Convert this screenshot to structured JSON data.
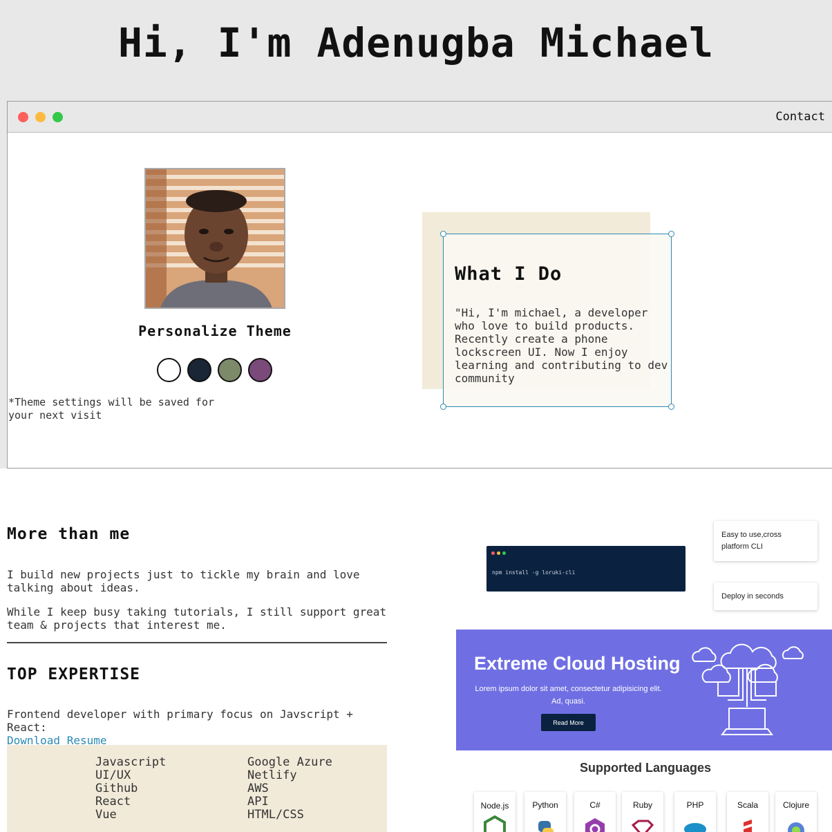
{
  "hero": {
    "title": "Hi, I'm Adenugba Michael"
  },
  "window": {
    "contact_label": "Contact"
  },
  "profile": {
    "theme_title": "Personalize Theme",
    "theme_swatches": [
      "#ffffff",
      "#1a2535",
      "#7d8a6a",
      "#7a4a7a"
    ],
    "theme_note": "*Theme settings will be saved for your next visit"
  },
  "what_i_do": {
    "title": "What I Do",
    "text": "\"Hi, I'm michael, a developer who love to build products. Recently create a phone lockscreen UI. Now I enjoy learning and contributing to dev community"
  },
  "about": {
    "title": "More than me",
    "paragraph_1": "I build new projects just to tickle my brain and love talking about ideas.",
    "paragraph_2": "While I keep busy taking tutorials, I still support great team & projects that interest me."
  },
  "expertise": {
    "title": "TOP EXPERTISE",
    "intro": "Frontend developer with primary focus on Javscript + React:",
    "download_label": "Download Resume",
    "skills_left": [
      "Javascript",
      "UI/UX",
      "Github",
      "React",
      "Vue"
    ],
    "skills_right": [
      "Google Azure",
      "Netlify",
      "AWS",
      "API",
      "HTML/CSS"
    ]
  },
  "cli_preview": {
    "command": "npm install -g loruki-cli",
    "feature_1": "Easy to use,cross platform CLI",
    "feature_2": "Deploy in seconds"
  },
  "hosting_banner": {
    "title": "Extreme Cloud Hosting",
    "text": "Lorem ipsum dolor sit amet, consectetur adipisicing elit. Ad, quasi.",
    "button_label": "Read More",
    "color": "#6f6fe3"
  },
  "languages": {
    "title": "Supported Languages",
    "items": [
      "Node.js",
      "Python",
      "C#",
      "Ruby",
      "PHP",
      "Scala",
      "Clojure"
    ]
  }
}
